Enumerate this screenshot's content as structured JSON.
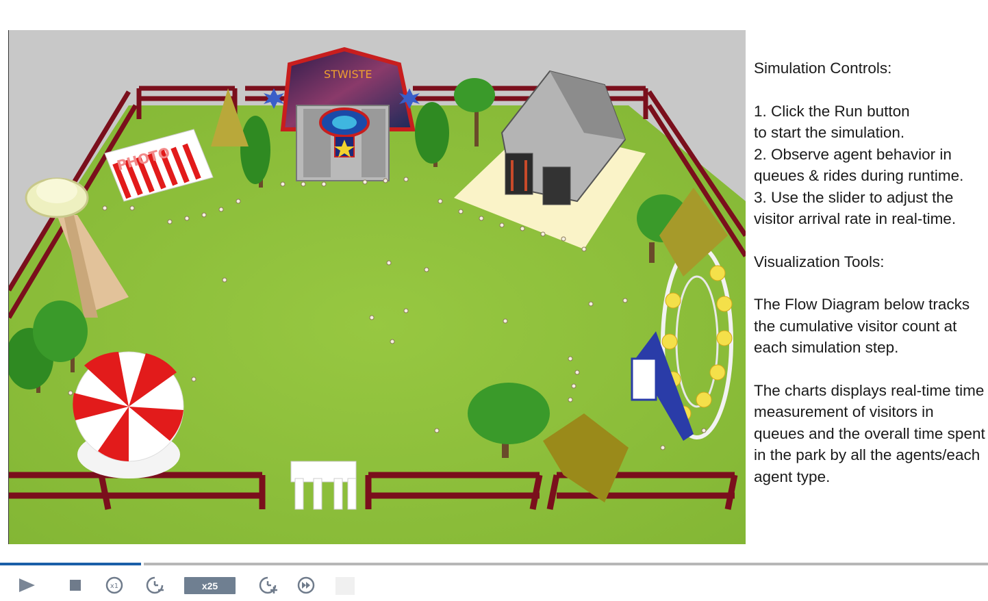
{
  "info": {
    "heading_controls": "Simulation Controls:",
    "controls_text": "1. Click the Run button\nto start the simulation.\n2. Observe agent behavior in queues & rides during runtime.\n3. Use the slider to adjust the visitor arrival rate in real-time.",
    "heading_viz": "Visualization Tools:",
    "flow_text": "The Flow Diagram below tracks the cumulative visitor count at each simulation step.",
    "charts_text": "The charts displays real-time time measurement of visitors in queues and the overall time spent in the park by all the agents/each agent type."
  },
  "scene": {
    "photo_booth_sign": "PHOTO",
    "twister_sign": "STWISTE"
  },
  "progress": {
    "fraction": 0.143
  },
  "toolbar": {
    "speed_label": "x25",
    "icons": [
      "play-icon",
      "stop-icon",
      "speed-x1-icon",
      "slow-down-icon",
      "speed-x25-badge",
      "speed-up-icon",
      "fast-forward-icon",
      "blank-button"
    ]
  },
  "colors": {
    "grass": "#8fc23b",
    "fence": "#7a0f1c",
    "accent_blue": "#1b5fa8",
    "badge": "#6f7f91"
  }
}
